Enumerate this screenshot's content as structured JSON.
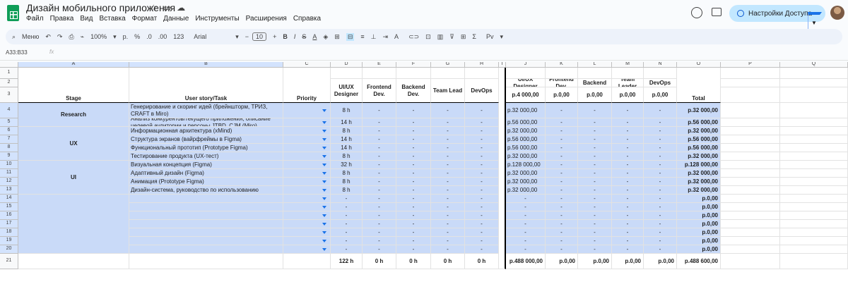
{
  "app": {
    "title": "Дизайн мобильного приложения",
    "menu": [
      "Файл",
      "Правка",
      "Вид",
      "Вставка",
      "Формат",
      "Данные",
      "Инструменты",
      "Расширения",
      "Справка"
    ],
    "share_label": "Настройки Доступа"
  },
  "toolbar": {
    "search": "Меню",
    "zoom": "100%",
    "currency": "р.",
    "percent": "%",
    "dec_less": ".0",
    "dec_more": ".00",
    "num_format": "123",
    "font": "Arial",
    "font_size": "10",
    "currency_menu": "Рv"
  },
  "formula_bar": {
    "name_box": "A33:B33",
    "fx": "fx"
  },
  "columns": [
    "A",
    "B",
    "C",
    "D",
    "E",
    "F",
    "G",
    "H",
    "I",
    "J",
    "K",
    "L",
    "M",
    "N",
    "O",
    "P",
    "Q"
  ],
  "row_numbers": [
    "1",
    "2",
    "3",
    "4",
    "5",
    "6",
    "7",
    "8",
    "9",
    "10",
    "11",
    "12",
    "13",
    "14",
    "15",
    "16",
    "17",
    "18",
    "19",
    "20",
    "21"
  ],
  "headers": {
    "stage": "Stage",
    "task": "User story/Task",
    "priority": "Priority",
    "roles": [
      "UI/UX Designer",
      "Frontend Dev.",
      "Backend Dev.",
      "Team Lead",
      "DevOps"
    ],
    "cost_roles": [
      "UI/UX Designer",
      "Frontend Dev.",
      "Backend",
      "Team Leader",
      "DevOps"
    ],
    "rates": [
      "р.4 000,00",
      "р.0,00",
      "р.0,00",
      "р.0,00",
      "р.0,00"
    ],
    "total": "Total"
  },
  "stages": [
    "Research",
    "UX",
    "UI"
  ],
  "rows": [
    {
      "task": "Генерирование и скоринг идей (брейншторм, ТРИЗ, CRAFT в Miro)",
      "d": "8 h",
      "e": "-",
      "f": "-",
      "g": "-",
      "h": "-",
      "j": "р.32 000,00",
      "k": "-",
      "l": "-",
      "m": "-",
      "n": "-",
      "o": "р.32 000,00"
    },
    {
      "task": "Анализ конкурентов/текущего приложения, описание целевой аудитории и персоны JTBD, CJM (Miro)",
      "d": "14 h",
      "e": "-",
      "f": "-",
      "g": "-",
      "h": "-",
      "j": "р.56 000,00",
      "k": "-",
      "l": "-",
      "m": "-",
      "n": "-",
      "o": "р.56 000,00"
    },
    {
      "task": "Информационная архитектура (xMind)",
      "d": "8 h",
      "e": "-",
      "f": "-",
      "g": "-",
      "h": "-",
      "j": "р.32 000,00",
      "k": "-",
      "l": "-",
      "m": "-",
      "n": "-",
      "o": "р.32 000,00"
    },
    {
      "task": "Структура экранов (вайрфреймы в Figma)",
      "d": "14 h",
      "e": "-",
      "f": "-",
      "g": "-",
      "h": "-",
      "j": "р.56 000,00",
      "k": "-",
      "l": "-",
      "m": "-",
      "n": "-",
      "o": "р.56 000,00"
    },
    {
      "task": "Функциональный прототип (Prototype Figma)",
      "d": "14 h",
      "e": "-",
      "f": "-",
      "g": "-",
      "h": "-",
      "j": "р.56 000,00",
      "k": "-",
      "l": "-",
      "m": "-",
      "n": "-",
      "o": "р.56 000,00"
    },
    {
      "task": "Тестирование продукта (UX-тест)",
      "d": "8 h",
      "e": "-",
      "f": "-",
      "g": "-",
      "h": "-",
      "j": "р.32 000,00",
      "k": "-",
      "l": "-",
      "m": "-",
      "n": "-",
      "o": "р.32 000,00"
    },
    {
      "task": "Визуальная концепция (Figma)",
      "d": "32 h",
      "e": "-",
      "f": "-",
      "g": "-",
      "h": "-",
      "j": "р.128 000,00",
      "k": "-",
      "l": "-",
      "m": "-",
      "n": "-",
      "o": "р.128 000,00"
    },
    {
      "task": "Адаптивный дизайн (Figma)",
      "d": "8 h",
      "e": "-",
      "f": "-",
      "g": "-",
      "h": "-",
      "j": "р.32 000,00",
      "k": "-",
      "l": "-",
      "m": "-",
      "n": "-",
      "o": "р.32 000,00"
    },
    {
      "task": "Анимация (Prototype Figma)",
      "d": "8 h",
      "e": "-",
      "f": "-",
      "g": "-",
      "h": "-",
      "j": "р.32 000,00",
      "k": "-",
      "l": "-",
      "m": "-",
      "n": "-",
      "o": "р.32 000,00"
    },
    {
      "task": "Дизайн-система, руководство по использованию",
      "d": "8 h",
      "e": "-",
      "f": "-",
      "g": "-",
      "h": "-",
      "j": "р.32 000,00",
      "k": "-",
      "l": "-",
      "m": "-",
      "n": "-",
      "o": "р.32 000,00"
    },
    {
      "task": "",
      "d": "-",
      "e": "-",
      "f": "-",
      "g": "-",
      "h": "-",
      "j": "-",
      "k": "-",
      "l": "-",
      "m": "-",
      "n": "-",
      "o": "р.0,00"
    },
    {
      "task": "",
      "d": "-",
      "e": "-",
      "f": "-",
      "g": "-",
      "h": "-",
      "j": "-",
      "k": "-",
      "l": "-",
      "m": "-",
      "n": "-",
      "o": "р.0,00"
    },
    {
      "task": "",
      "d": "-",
      "e": "-",
      "f": "-",
      "g": "-",
      "h": "-",
      "j": "-",
      "k": "-",
      "l": "-",
      "m": "-",
      "n": "-",
      "o": "р.0,00"
    },
    {
      "task": "",
      "d": "-",
      "e": "-",
      "f": "-",
      "g": "-",
      "h": "-",
      "j": "-",
      "k": "-",
      "l": "-",
      "m": "-",
      "n": "-",
      "o": "р.0,00"
    },
    {
      "task": "",
      "d": "-",
      "e": "-",
      "f": "-",
      "g": "-",
      "h": "-",
      "j": "-",
      "k": "-",
      "l": "-",
      "m": "-",
      "n": "-",
      "o": "р.0,00"
    },
    {
      "task": "",
      "d": "-",
      "e": "-",
      "f": "-",
      "g": "-",
      "h": "-",
      "j": "-",
      "k": "-",
      "l": "-",
      "m": "-",
      "n": "-",
      "o": "р.0,00"
    },
    {
      "task": "",
      "d": "-",
      "e": "-",
      "f": "-",
      "g": "-",
      "h": "-",
      "j": "-",
      "k": "-",
      "l": "-",
      "m": "-",
      "n": "-",
      "o": "р.0,00"
    }
  ],
  "totals": {
    "d": "122 h",
    "e": "0 h",
    "f": "0 h",
    "g": "0 h",
    "h": "0 h",
    "j": "р.488 000,00",
    "k": "р.0,00",
    "l": "р.0,00",
    "m": "р.0,00",
    "n": "р.0,00",
    "o": "р.488 600,00"
  }
}
